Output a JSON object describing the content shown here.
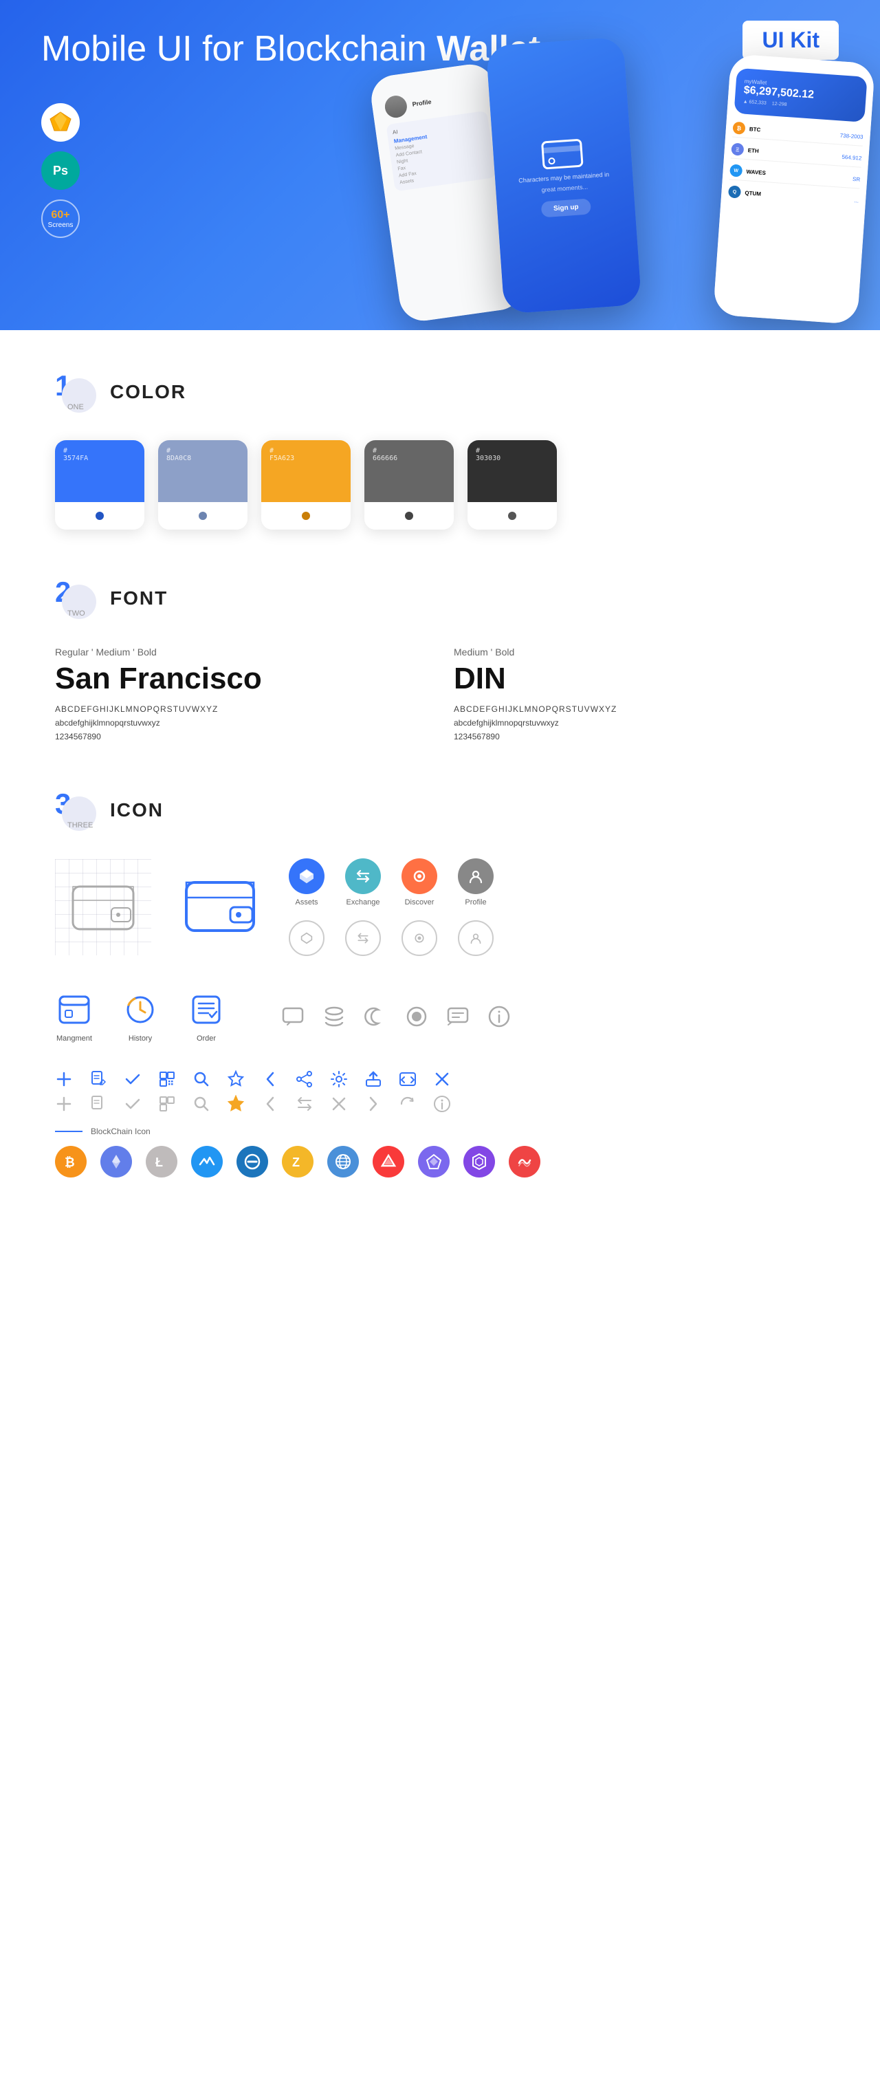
{
  "hero": {
    "title_normal": "Mobile UI for Blockchain ",
    "title_bold": "Wallet",
    "badge": "UI Kit",
    "badges": [
      {
        "type": "sketch",
        "label": "S"
      },
      {
        "type": "ps",
        "label": "Ps"
      },
      {
        "type": "count",
        "line1": "60+",
        "line2": "Screens"
      }
    ]
  },
  "sections": {
    "color": {
      "number": "1",
      "sub": "ONE",
      "title": "COLOR",
      "swatches": [
        {
          "hex": "#3574FA",
          "display": "#\n3574FA",
          "dot_color": "#2255c4"
        },
        {
          "hex": "#8DA0C8",
          "display": "#\n8DA0C8",
          "dot_color": "#6d84b0"
        },
        {
          "hex": "#F5A623",
          "display": "#\nF5A623",
          "dot_color": "#c97e08"
        },
        {
          "hex": "#666666",
          "display": "#\n666666",
          "dot_color": "#444"
        },
        {
          "hex": "#303030",
          "display": "#\n303030",
          "dot_color": "#555"
        }
      ]
    },
    "font": {
      "number": "2",
      "sub": "TWO",
      "title": "FONT",
      "fonts": [
        {
          "style_label": "Regular ' Medium ' Bold",
          "name": "San Francisco",
          "uppercase": "ABCDEFGHIJKLMNOPQRSTUVWXYZ",
          "lowercase": "abcdefghijklmnopqrstuvwxyz",
          "numbers": "1234567890"
        },
        {
          "style_label": "Medium ' Bold",
          "name": "DIN",
          "uppercase": "ABCDEFGHIJKLMNOPQRSTUVWXYZ",
          "lowercase": "abcdefghijklmnopqrstuvwxyz",
          "numbers": "1234567890"
        }
      ]
    },
    "icon": {
      "number": "3",
      "sub": "THREE",
      "title": "ICON",
      "colored_icons_row1": [
        {
          "label": "Assets",
          "bg": "#3574fa",
          "glyph": "◆"
        },
        {
          "label": "Exchange",
          "bg": "#4fb8c8",
          "glyph": "⇄"
        },
        {
          "label": "Discover",
          "bg": "#ff7043",
          "glyph": "●"
        },
        {
          "label": "Profile",
          "bg": "#888",
          "glyph": "👤"
        }
      ],
      "colored_icons_row2": [
        {
          "label": "",
          "bg": "outline",
          "glyph": "◆"
        },
        {
          "label": "",
          "bg": "outline",
          "glyph": "⇄"
        },
        {
          "label": "",
          "bg": "outline",
          "glyph": "●"
        },
        {
          "label": "",
          "bg": "outline",
          "glyph": "👤"
        }
      ],
      "labeled_icons": [
        {
          "label": "Mangment",
          "type": "blue"
        },
        {
          "label": "History",
          "type": "blue"
        },
        {
          "label": "Order",
          "type": "blue"
        }
      ],
      "misc_icons": [
        "▤",
        "≡",
        "☽",
        "●",
        "▣",
        "ℹ"
      ],
      "small_icons_blue": [
        "+",
        "📋",
        "✓",
        "⊞",
        "🔍",
        "☆",
        "<",
        "≪",
        "⚙",
        "⬡",
        "⬜",
        "✕"
      ],
      "small_icons_gray": [
        "+",
        "📋",
        "✓",
        "⊞",
        "🔍",
        "☆",
        "<",
        "≪",
        "⊘",
        "→",
        "⬜",
        "✕"
      ],
      "blockchain_label": "BlockChain Icon",
      "blockchain_icons": [
        {
          "label": "BTC",
          "bg": "#f7931a",
          "color": "#fff",
          "symbol": "₿"
        },
        {
          "label": "ETH",
          "bg": "#627eea",
          "color": "#fff",
          "symbol": "Ξ"
        },
        {
          "label": "LTC",
          "bg": "#bfbbbb",
          "color": "#fff",
          "symbol": "Ł"
        },
        {
          "label": "WAVES",
          "bg": "#2196f3",
          "color": "#fff",
          "symbol": "W"
        },
        {
          "label": "DASH",
          "bg": "#1c75bc",
          "color": "#fff",
          "symbol": "D"
        },
        {
          "label": "ZEC",
          "bg": "#f4b728",
          "color": "#fff",
          "symbol": "Z"
        },
        {
          "label": "NET",
          "bg": "#4a90d9",
          "color": "#fff",
          "symbol": "◉"
        },
        {
          "label": "ARK",
          "bg": "#f93a3a",
          "color": "#fff",
          "symbol": "▲"
        },
        {
          "label": "POA",
          "bg": "#7b68ee",
          "color": "#fff",
          "symbol": "◈"
        },
        {
          "label": "MATIC",
          "bg": "#8247e5",
          "color": "#fff",
          "symbol": "⬡"
        },
        {
          "label": "SXP",
          "bg": "#ef4444",
          "color": "#fff",
          "symbol": "〜"
        }
      ]
    }
  }
}
